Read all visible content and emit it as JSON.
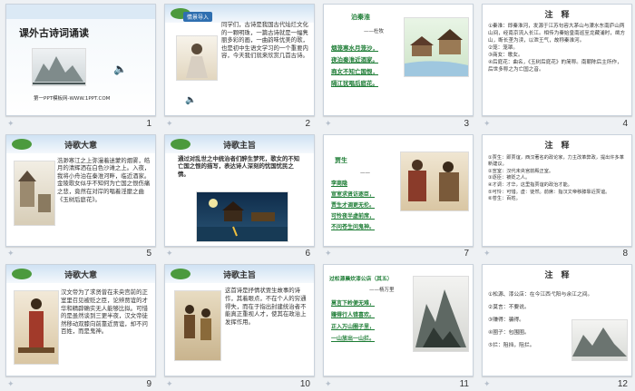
{
  "slides": [
    {
      "num": "1",
      "title": "课外古诗词诵读",
      "footer": "第一PPT模板网-WWW.1PPT.COM"
    },
    {
      "num": "2",
      "badge": "情景导入",
      "text": "同学们，古诗是我国古代灿烂文化的一颗明珠，一篇古诗就是一幅隽丽多彩的画，一曲韵味优美的歌，也是初中生语文学习的一个重要内容，今天我们就来欣赏几首古诗。"
    },
    {
      "num": "3",
      "title": "泊秦淮",
      "author": "——杜牧",
      "lines": [
        "烟笼寒水月笼沙，",
        "夜泊秦淮近酒家。",
        "商女不知亡国恨，",
        "隔江犹唱后庭花。"
      ]
    },
    {
      "num": "4",
      "title": "注　释",
      "lines": [
        "①秦淮：即秦淮河，发源于江苏句容大茅山与溧水东南庐山两山间，经南京流入长江。相传为秦始皇南巡至龙藏浦时，凿方山，断长垄为渎，以泄王气，故称秦淮河。",
        "②笼：笼罩。",
        "③商女：歌女。",
        "④后庭花：曲名，《玉树后庭花》的简称。南朝陈后主所作，后世多称之为亡国之音。"
      ]
    },
    {
      "num": "5",
      "title": "诗歌大意",
      "text": "浩渺寒江之上弥漫着迷蒙的烟雾，皓月的清辉洒在白色沙滩之上。入夜，我将小舟泊在秦淮河畔，临近酒家。金陵歌女似乎不知何为亡国之恨伤痛之悲，竟然在对岸的唱着淫靡之曲《玉树后庭花》。"
    },
    {
      "num": "6",
      "title": "诗歌主旨",
      "text": "通过对乱世之中统治者们醉生梦死，歌女的不知亡国之恨的描写，表达诗人深刻的忧国忧民之情。"
    },
    {
      "num": "7",
      "title": "贾生",
      "author": "——",
      "lines": [
        "李商隐",
        "宣室求贤访逐臣，",
        "贾生才调更无伦。",
        "可怜夜半虚前席，",
        "不问苍生问鬼神。"
      ]
    },
    {
      "num": "8",
      "title": "注　释",
      "lines": [
        "①贾生：即贾谊，西汉著名的政论家，力主改革弊政，提出许多革新建议。",
        "②宣室：汉代未央宫前殿正室。",
        "③逐臣：被贬之人。",
        "④才调：才华，这里指贾谊的政治才能。",
        "⑤可怜：可惜。虚：徒然。前席：指汉文帝移膝靠近贾谊。",
        "⑥苍生：百姓。"
      ]
    },
    {
      "num": "9",
      "title": "诗歌大意",
      "text": "汉文帝为了求贤曾在未央宫前的正室里召见被贬之臣，论辨贾谊的才华和精辟确实无人能够比拟。可惜的是虽然谈到三更半夜，汉文帝徒然移动双膝向前靠近贾谊，却不问百姓，而是鬼神。"
    },
    {
      "num": "10",
      "title": "诗歌主旨",
      "text": "这首诗是抒情状贾生故事的诗作，其着眼点，不在个人的穷通得失，而在于指出封建统治者不能真正重视人才，使其在政治上发挥作用。"
    },
    {
      "num": "11",
      "title": "过松源晨炊漆公店（其五）",
      "author": "——杨万里",
      "lines": [
        "莫言下岭便无难，",
        "赚得行人错喜欢。",
        "正入万山圈子里，",
        "一山放出一山拦。"
      ]
    },
    {
      "num": "12",
      "title": "注　释",
      "lines": [
        "①松源、漆公店：在今江西弋阳与余江之间。",
        "②莫言：不要说。",
        "③赚得：骗得。",
        "④圈子：包围圈。",
        "⑤拦：阻挡，阻拦。"
      ]
    }
  ]
}
